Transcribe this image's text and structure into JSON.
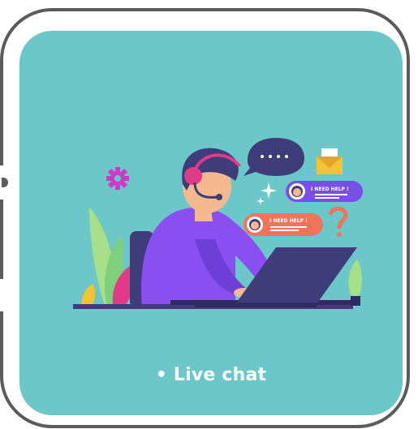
{
  "card": {
    "caption": "• Live chat",
    "bubble_primary_text": "I NEED HELP !",
    "bubble_secondary_text": "I NEED HELP !"
  },
  "colors": {
    "frame": "#5b5b5b",
    "card_background": "#6cc7c9",
    "shirt": "#8a4ff0",
    "headset": "#e03a88",
    "laptop": "#3e3d7a",
    "bubble_purple": "#7a4fe8",
    "bubble_orange": "#f0735a"
  },
  "icons": [
    "gear-icon",
    "speech-bubble-icon",
    "envelope-icon",
    "sparkle-icon",
    "question-mark-icon",
    "plant-icon"
  ]
}
